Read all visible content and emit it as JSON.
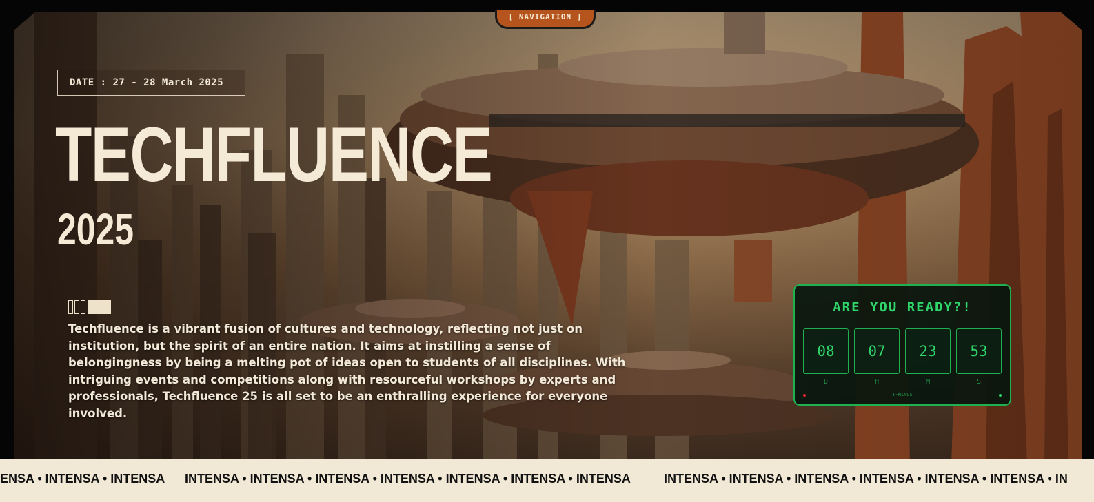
{
  "nav": {
    "label": "[ NAVIGATION ]"
  },
  "hero": {
    "date": "DATE : 27 - 28 March 2025",
    "title": "TECHFLUENCE",
    "year": "2025",
    "description": "Techfluence is a vibrant fusion of cultures and technology, reflecting not just on institution, but the spirit of an entire nation. It aims at instilling a sense of belongingness by being a melting pot of ideas open to students of all disciplines. With intriguing events and competitions along with resourceful workshops by experts and professionals, Techfluence 25 is all set to be an enthralling experience for everyone involved."
  },
  "countdown": {
    "title": "ARE YOU READY?!",
    "days": "08",
    "hours": "07",
    "minutes": "23",
    "seconds": "53",
    "label_d": "D",
    "label_h": "H",
    "label_m": "M",
    "label_s": "S",
    "footer": "T-MINUS",
    "accent": "#2fd66a",
    "dot_left_color": "#e0262d",
    "dot_right_color": "#2fd66a"
  },
  "ticker": {
    "segment_1": "ENSA • INTENSA • INTENSA",
    "segment_2": "INTENSA • INTENSA • INTENSA • INTENSA • INTENSA • INTENSA • INTENSA",
    "segment_3": "INTENSA • INTENSA • INTENSA • INTENSA • INTENSA • INTENSA • IN"
  },
  "colors": {
    "cream": "#f4ead6",
    "nav_orange": "#b5551d",
    "countdown_green": "#1fb050"
  }
}
